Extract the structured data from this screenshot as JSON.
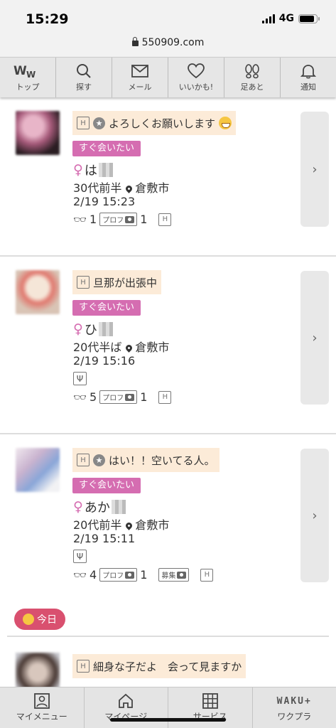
{
  "status": {
    "time": "15:29",
    "network": "4G",
    "battery_level": 0.85
  },
  "url": "550909.com",
  "topnav": [
    {
      "label": "トップ",
      "icon": "logo-ww-icon"
    },
    {
      "label": "探す",
      "icon": "search-icon"
    },
    {
      "label": "メール",
      "icon": "mail-icon"
    },
    {
      "label": "いいかも!",
      "icon": "heart-icon"
    },
    {
      "label": "足あと",
      "icon": "footprints-icon"
    },
    {
      "label": "通知",
      "icon": "bell-icon"
    }
  ],
  "cards": [
    {
      "message": "よろしくお願いします",
      "tag": "すぐ会いたい",
      "name": "は",
      "age": "30代前半",
      "location": "倉敷市",
      "time": "2/19 15:23",
      "views": "1",
      "prof_count": "1",
      "prof_label": "プロフ"
    },
    {
      "message": "旦那が出張中",
      "tag": "すぐ会いたい",
      "name": "ひ",
      "age": "20代半ば",
      "location": "倉敷市",
      "time": "2/19 15:16",
      "views": "5",
      "prof_count": "1",
      "prof_label": "プロフ"
    },
    {
      "message": "はい！！空いてる人。",
      "tag": "すぐ会いたい",
      "name": "あか",
      "age": "20代前半",
      "location": "倉敷市",
      "time": "2/19 15:11",
      "views": "4",
      "prof_count": "1",
      "prof_label": "プロフ",
      "recruit_label": "募集"
    },
    {
      "message": "細身な子だよ　会って見ますか"
    }
  ],
  "today_label": "今日",
  "bottomnav": [
    {
      "label": "マイメニュー",
      "icon": "user-card-icon"
    },
    {
      "label": "マイページ",
      "icon": "home-icon"
    },
    {
      "label": "サービス",
      "icon": "grid-icon"
    },
    {
      "label": "ワクプラ",
      "icon": "waku-plus-icon",
      "logo_text": "WAKU+"
    }
  ]
}
